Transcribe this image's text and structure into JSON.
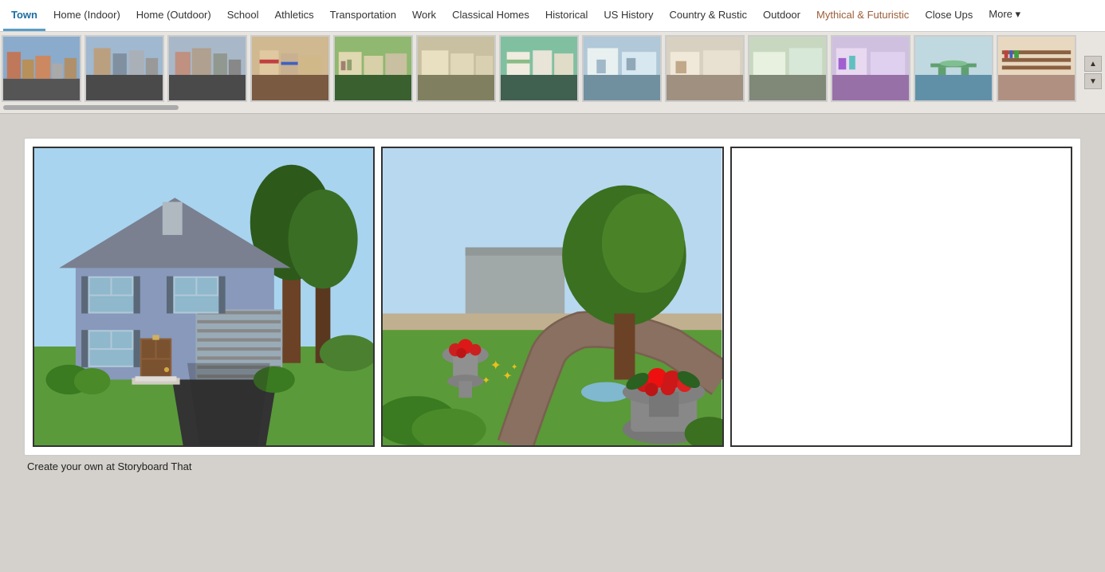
{
  "nav": {
    "items": [
      {
        "id": "town",
        "label": "Town",
        "active": true
      },
      {
        "id": "home-indoor",
        "label": "Home (Indoor)",
        "active": false
      },
      {
        "id": "home-outdoor",
        "label": "Home (Outdoor)",
        "active": false
      },
      {
        "id": "school",
        "label": "School",
        "active": false
      },
      {
        "id": "athletics",
        "label": "Athletics",
        "active": false
      },
      {
        "id": "transportation",
        "label": "Transportation",
        "active": false
      },
      {
        "id": "work",
        "label": "Work",
        "active": false
      },
      {
        "id": "classical-homes",
        "label": "Classical Homes",
        "active": false
      },
      {
        "id": "historical",
        "label": "Historical",
        "active": false
      },
      {
        "id": "us-history",
        "label": "US History",
        "active": false
      },
      {
        "id": "country-rustic",
        "label": "Country & Rustic",
        "active": false
      },
      {
        "id": "outdoor",
        "label": "Outdoor",
        "active": false
      },
      {
        "id": "mythical-futuristic",
        "label": "Mythical & Futuristic",
        "active": false,
        "special": true
      },
      {
        "id": "close-ups",
        "label": "Close Ups",
        "active": false
      },
      {
        "id": "more",
        "label": "More ▾",
        "active": false
      }
    ]
  },
  "strip": {
    "scroll_up_label": "▲",
    "scroll_down_label": "▼",
    "thumbnails": [
      {
        "id": 1,
        "class": "thumb-1"
      },
      {
        "id": 2,
        "class": "thumb-2"
      },
      {
        "id": 3,
        "class": "thumb-3"
      },
      {
        "id": 4,
        "class": "thumb-4"
      },
      {
        "id": 5,
        "class": "thumb-5"
      },
      {
        "id": 6,
        "class": "thumb-6"
      },
      {
        "id": 7,
        "class": "thumb-7"
      },
      {
        "id": 8,
        "class": "thumb-8"
      },
      {
        "id": 9,
        "class": "thumb-9"
      },
      {
        "id": 10,
        "class": "thumb-10"
      },
      {
        "id": 11,
        "class": "thumb-11"
      },
      {
        "id": 12,
        "class": "thumb-12"
      },
      {
        "id": 13,
        "class": "thumb-13"
      }
    ]
  },
  "storyboard": {
    "caption": "Create your own at Storyboard That",
    "cells": [
      {
        "id": "cell-1",
        "type": "house-scene"
      },
      {
        "id": "cell-2",
        "type": "garden-scene"
      },
      {
        "id": "cell-3",
        "type": "empty"
      }
    ]
  }
}
